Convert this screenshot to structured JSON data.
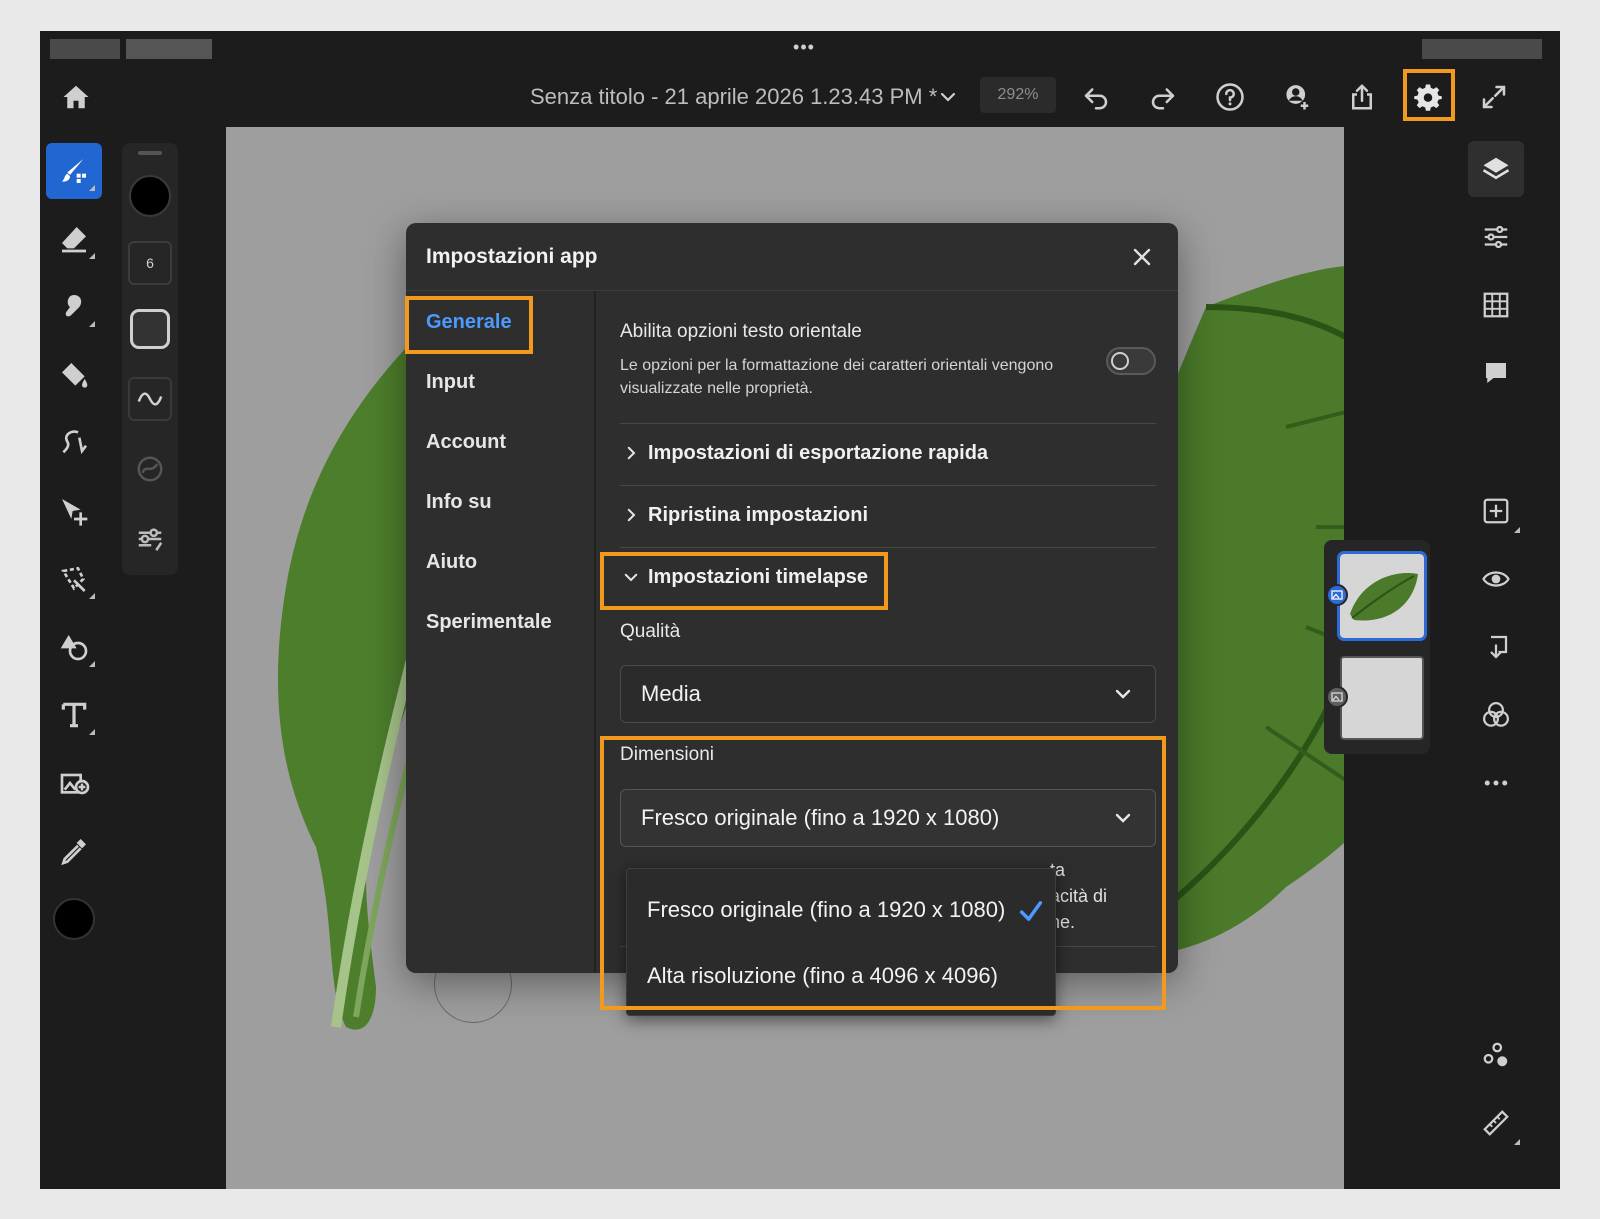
{
  "statusbar": {
    "more_dots": "•••"
  },
  "topbar": {
    "doc_title": "Senza titolo - 21 aprile 2026 1.23.43 PM *",
    "zoom": "292%",
    "icons": [
      "home-icon",
      "chevron-down-icon",
      "undo-icon",
      "redo-icon",
      "help-icon",
      "invite-icon",
      "share-icon",
      "gear-icon",
      "fullscreen-icon"
    ]
  },
  "brush_panel": {
    "size": "6"
  },
  "dialog": {
    "title": "Impostazioni app",
    "nav": [
      "Generale",
      "Input",
      "Account",
      "Info su",
      "Aiuto",
      "Sperimentale"
    ],
    "active_nav": "Generale",
    "oriental": {
      "title": "Abilita opzioni testo orientale",
      "desc": "Le opzioni per la formattazione dei caratteri orientali vengono visualizzate nelle proprietà.",
      "enabled": false
    },
    "sections": {
      "quick_export": "Impostazioni di esportazione rapida",
      "reset": "Ripristina impostazioni",
      "timelapse": "Impostazioni timelapse"
    },
    "quality": {
      "label": "Qualità",
      "value": "Media"
    },
    "dimensions": {
      "label": "Dimensioni",
      "value": "Fresco originale (fino a 1920 x 1080)",
      "options": [
        "Fresco originale (fino a 1920 x 1080)",
        "Alta risoluzione (fino a 4096 x 4096)"
      ],
      "selected_index": 0
    },
    "partial_desc": [
      "ta",
      "acità di",
      "ne."
    ]
  },
  "colors": {
    "accent_blue": "#2166d1",
    "link_blue": "#4b9bff",
    "highlight_orange": "#f29a1e",
    "panel_bg": "#2e2e2e",
    "app_bg": "#1c1c1c"
  }
}
